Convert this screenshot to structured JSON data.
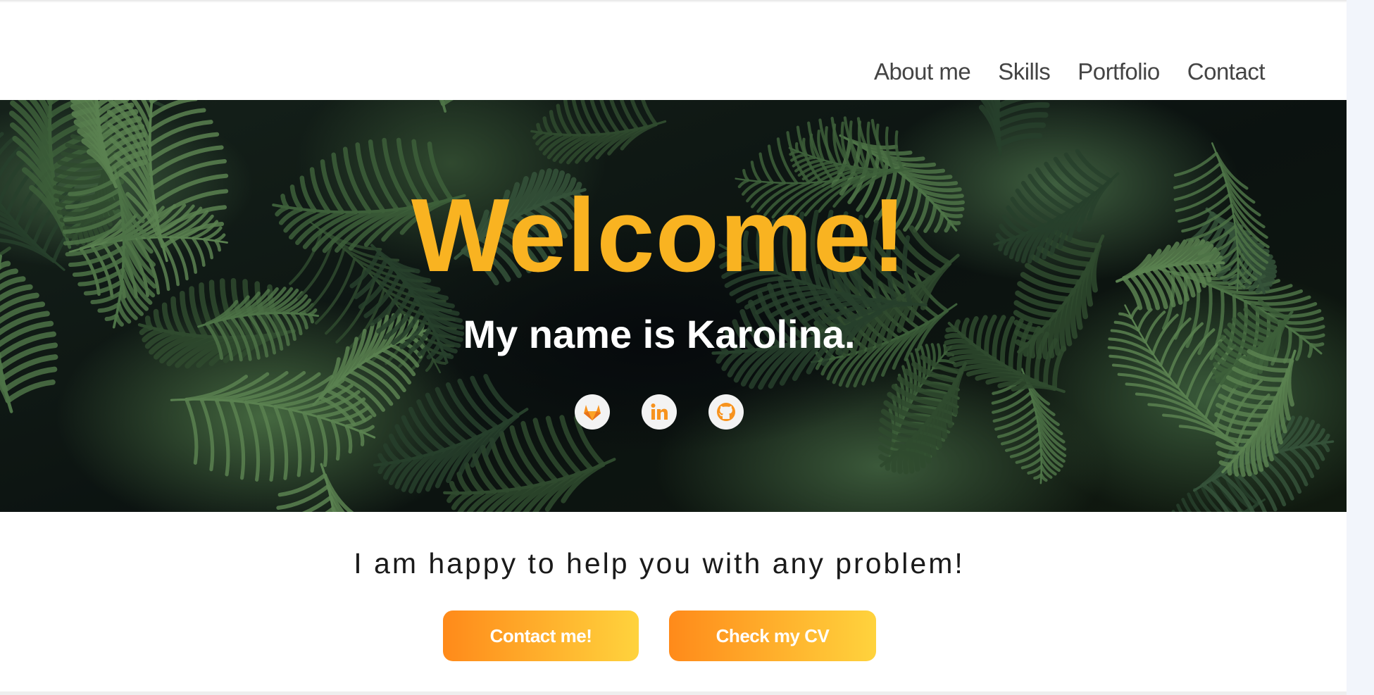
{
  "nav": {
    "items": [
      {
        "label": "About me"
      },
      {
        "label": "Skills"
      },
      {
        "label": "Portfolio"
      },
      {
        "label": "Contact"
      }
    ]
  },
  "hero": {
    "title": "Welcome!",
    "subtitle": "My name is Karolina.",
    "social_icons": [
      "gitlab-icon",
      "linkedin-icon",
      "github-icon"
    ],
    "icon_color": "#f7931e",
    "title_color": "#f9b321"
  },
  "intro": {
    "tagline": "I am happy to help you with any problem!",
    "contact_button": "Contact me!",
    "cv_button": "Check my CV",
    "button_gradient": [
      "#ff8a1a",
      "#ffd33d"
    ]
  }
}
